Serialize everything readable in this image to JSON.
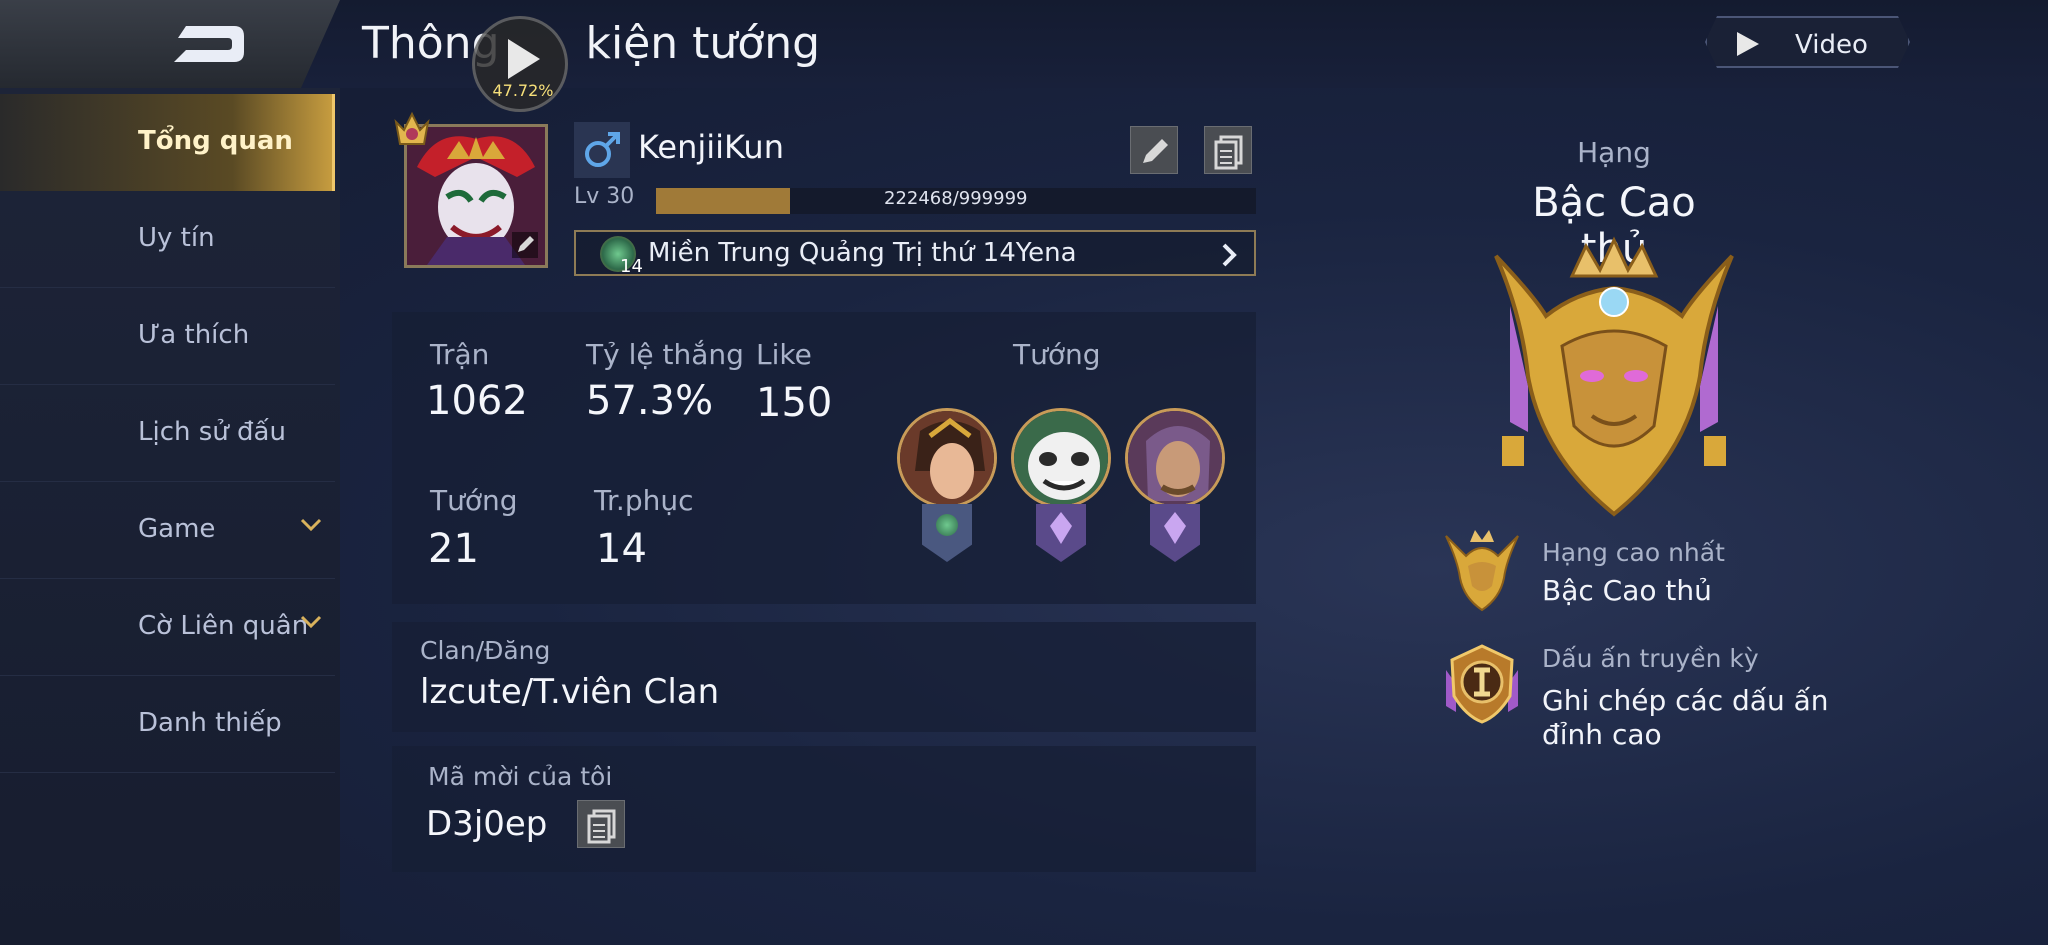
{
  "header": {
    "title": "Thông tin sự kiện tướng",
    "title_visible_left": "Thông",
    "title_visible_right": "kiện tướng",
    "play_percent": "47.72%",
    "video_label": "Video"
  },
  "sidebar": {
    "items": [
      {
        "label": "Tổng quan",
        "active": true
      },
      {
        "label": "Uy tín"
      },
      {
        "label": "Ưa thích"
      },
      {
        "label": "Lịch sử đấu"
      },
      {
        "label": "Game",
        "has_dropdown": true
      },
      {
        "label": "Cờ Liên quân",
        "has_dropdown": true
      },
      {
        "label": "Danh thiếp"
      }
    ]
  },
  "profile": {
    "name": "KenjiiKun",
    "gender_icon": "male-icon",
    "level": "Lv 30",
    "xp_text": "222468/999999",
    "xp_fraction": 0.222468,
    "server": "Miền Trung Quảng Trị thứ 14Yena",
    "server_badge": "14"
  },
  "stats": {
    "matches_label": "Trận",
    "matches": "1062",
    "winrate_label": "Tỷ lệ thắng",
    "winrate": "57.3%",
    "like_label": "Like",
    "like": "150",
    "heroes_label": "Tướng",
    "heroes": "21",
    "skins_label": "Tr.phục",
    "skins": "14",
    "top_heroes_label": "Tướng"
  },
  "clan": {
    "label": "Clan/Đăng",
    "value": "lzcute/T.viên Clan"
  },
  "invite": {
    "label": "Mã mời của tôi",
    "code": "D3j0ep"
  },
  "rank": {
    "label": "Hạng",
    "current": "Bậc Cao thủ",
    "highest_label": "Hạng cao nhất",
    "highest": "Bậc Cao thủ",
    "legend_label": "Dấu ấn truyền kỳ",
    "legend_desc_line1": "Ghi chép các dấu ấn",
    "legend_desc_line2": "đỉnh cao"
  },
  "colors": {
    "accent_gold": "#c69c3f",
    "background": "#1a2440",
    "panel": "#161e34"
  }
}
